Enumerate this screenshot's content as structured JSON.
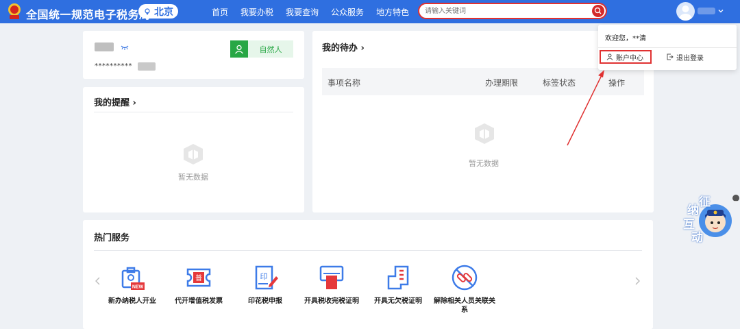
{
  "header": {
    "site_title": "全国统一规范电子税务局",
    "region": "北京",
    "nav": [
      "首页",
      "我要办税",
      "我要查询",
      "公众服务",
      "地方特色"
    ],
    "search_placeholder": "请输入关键词"
  },
  "profile": {
    "masked_id": "**********",
    "person_type": "自然人"
  },
  "reminders": {
    "title": "我的提醒",
    "empty": "暂无数据"
  },
  "todo": {
    "title": "我的待办",
    "columns": [
      "事项名称",
      "办理期限",
      "标签状态",
      "操作"
    ],
    "empty": "暂无数据"
  },
  "hot_services": {
    "title": "热门服务",
    "items": [
      {
        "label": "新办纳税人开业",
        "icon": "briefcase-new-icon",
        "badge": "NEW"
      },
      {
        "label": "代开增值税发票",
        "icon": "invoice-ticket-icon",
        "badge": "普"
      },
      {
        "label": "印花税申报",
        "icon": "stamp-doc-icon",
        "badge": "印"
      },
      {
        "label": "开具税收完税证明",
        "icon": "printer-cert-icon"
      },
      {
        "label": "开具无欠税证明",
        "icon": "document-icon"
      },
      {
        "label": "解除相关人员关联关系",
        "icon": "unlink-icon"
      }
    ]
  },
  "user_menu": {
    "welcome": "欢迎您，**清",
    "account": "账户中心",
    "logout": "退出登录"
  },
  "assistant": {
    "chars": [
      "征",
      "纳",
      "互",
      "动"
    ]
  },
  "colors": {
    "brand": "#2f6fe0",
    "highlight": "#e03131",
    "green": "#28a745",
    "icon_blue": "#3d7be8",
    "icon_red": "#e5383b"
  }
}
